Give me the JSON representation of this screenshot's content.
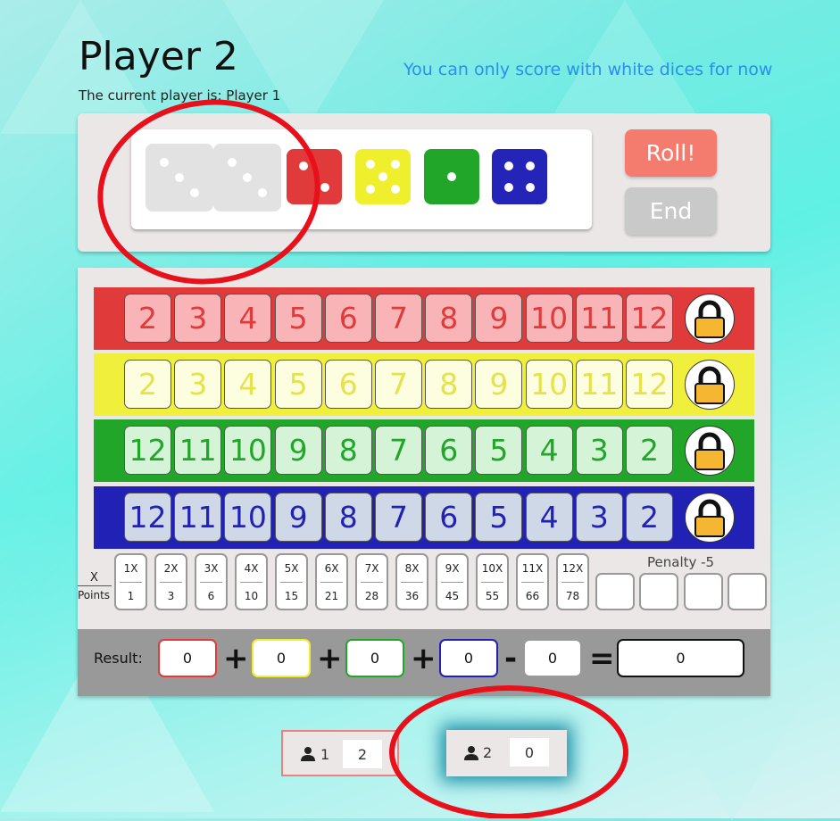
{
  "header": {
    "title": "Player 2",
    "current_player_text": "The current player is: Player 1",
    "notice": "You can only score with white dices for now"
  },
  "dice": [
    {
      "name": "white-die-1",
      "color": "#e2e2e2",
      "value": 3
    },
    {
      "name": "white-die-2",
      "color": "#e2e2e2",
      "value": 3
    },
    {
      "name": "red-die",
      "color": "#e03a3a",
      "value": 2
    },
    {
      "name": "yellow-die",
      "color": "#efef2e",
      "value": 5
    },
    {
      "name": "green-die",
      "color": "#21a62a",
      "value": 1
    },
    {
      "name": "blue-die",
      "color": "#2424b8",
      "value": 4
    }
  ],
  "buttons": {
    "roll": "Roll!",
    "end": "End"
  },
  "rows": [
    {
      "name": "red",
      "bg": "#e03a3a",
      "cell_bg": "#f8b4b7",
      "text": "#e03a3a",
      "numbers": [
        "2",
        "3",
        "4",
        "5",
        "6",
        "7",
        "8",
        "9",
        "10",
        "11",
        "12"
      ]
    },
    {
      "name": "yellow",
      "bg": "#f0ef3c",
      "cell_bg": "#fdfde0",
      "text": "#e5e24a",
      "numbers": [
        "2",
        "3",
        "4",
        "5",
        "6",
        "7",
        "8",
        "9",
        "10",
        "11",
        "12"
      ]
    },
    {
      "name": "green",
      "bg": "#21a62a",
      "cell_bg": "#d5f3d7",
      "text": "#21a62a",
      "numbers": [
        "12",
        "11",
        "10",
        "9",
        "8",
        "7",
        "6",
        "5",
        "4",
        "3",
        "2"
      ]
    },
    {
      "name": "blue",
      "bg": "#2121b5",
      "cell_bg": "#cfd8e6",
      "text": "#2121b5",
      "numbers": [
        "12",
        "11",
        "10",
        "9",
        "8",
        "7",
        "6",
        "5",
        "4",
        "3",
        "2"
      ]
    }
  ],
  "scoring": {
    "x_label": "X",
    "points_label": "Points",
    "multipliers": [
      "1X",
      "2X",
      "3X",
      "4X",
      "5X",
      "6X",
      "7X",
      "8X",
      "9X",
      "10X",
      "11X",
      "12X"
    ],
    "points": [
      "1",
      "3",
      "6",
      "10",
      "15",
      "21",
      "28",
      "36",
      "45",
      "55",
      "66",
      "78"
    ],
    "penalty_label": "Penalty -5"
  },
  "result": {
    "label": "Result:",
    "red": "0",
    "yellow": "0",
    "green": "0",
    "blue": "0",
    "penalty": "0",
    "total": "0",
    "plus": "+",
    "minus": "-",
    "equals": "="
  },
  "players": [
    {
      "number": "1",
      "score": "2"
    },
    {
      "number": "2",
      "score": "0"
    }
  ],
  "colors": {
    "accent_roll": "#f47c6f",
    "end_btn": "#c9c9c9",
    "notice": "#2a8ff0",
    "annotation_red": "#e8101b"
  }
}
